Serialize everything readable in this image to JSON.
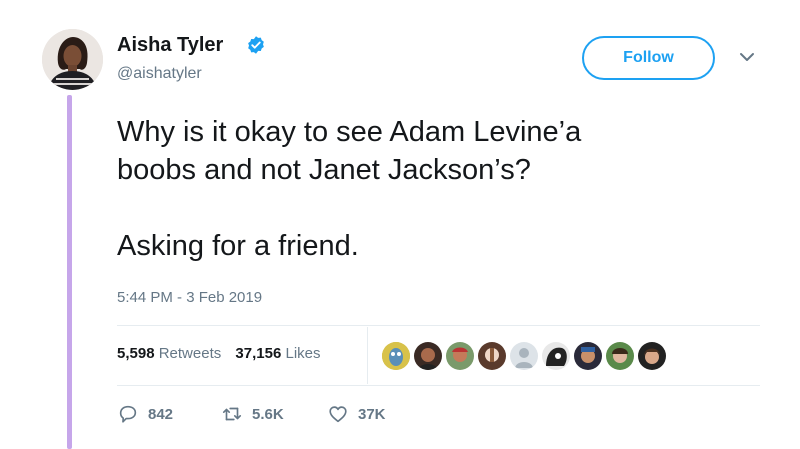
{
  "tweet": {
    "display_name": "Aisha Tyler",
    "handle": "@aishatyler",
    "verified_icon": "verified-badge-icon",
    "follow_label": "Follow",
    "text_lines": [
      "Why is it okay to see Adam Levine’a",
      "boobs and not Janet Jackson’s?",
      "Asking for a friend."
    ],
    "timestamp": "5:44 PM - 3 Feb 2019",
    "stats": {
      "retweets_count": "5,598",
      "retweets_label": "Retweets",
      "likes_count": "37,156",
      "likes_label": "Likes"
    },
    "liker_avatars": 10,
    "actions": {
      "reply_count": "842",
      "retweet_count": "5.6K",
      "like_count": "37K"
    }
  },
  "colors": {
    "accent": "#1da1f2",
    "thread_line": "#c6a6ea",
    "secondary_text": "#657786"
  }
}
